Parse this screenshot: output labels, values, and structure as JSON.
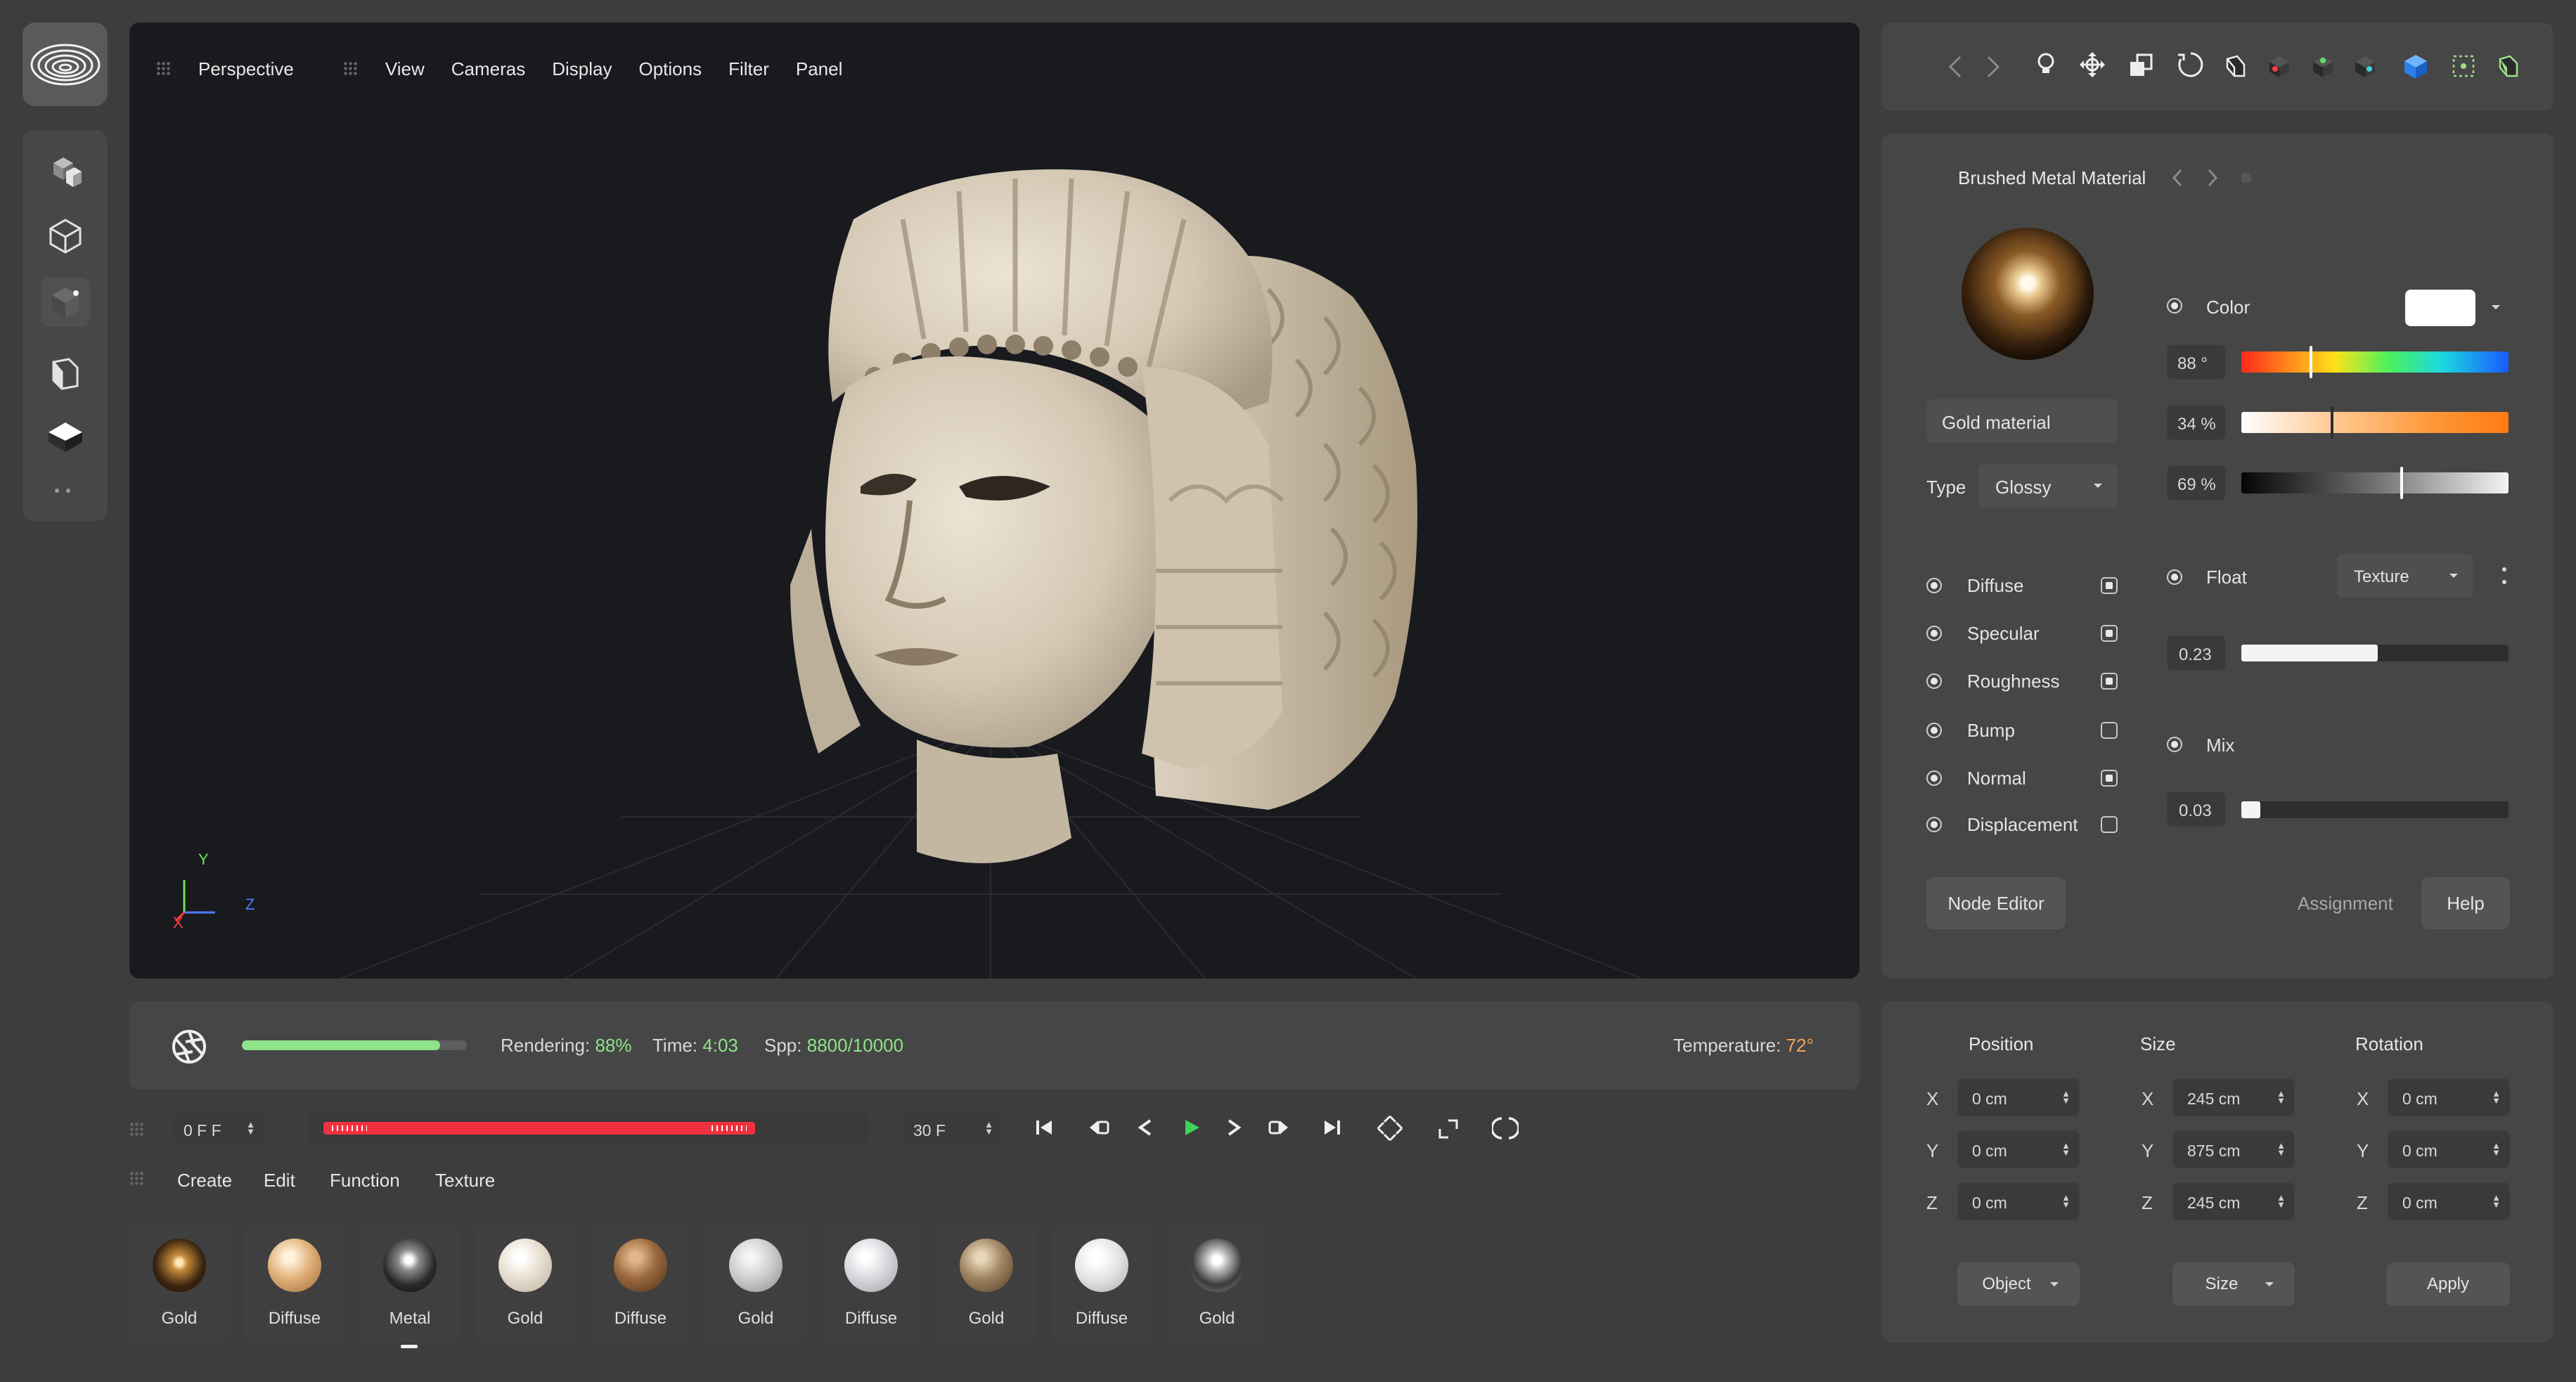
{
  "viewport": {
    "view_mode": "Perspective",
    "menu": [
      "View",
      "Cameras",
      "Display",
      "Options",
      "Filter",
      "Panel"
    ],
    "axes": {
      "x": "X",
      "y": "Y",
      "z": "Z"
    }
  },
  "status": {
    "rendering_label": "Rendering:",
    "rendering_value": "88%",
    "render_progress": 0.88,
    "time_label": "Time:",
    "time_value": "4:03",
    "spp_label": "Spp:",
    "spp_value": "8800/10000",
    "temperature_label": "Temperature:",
    "temperature_value": "72°",
    "accent_green": "#8fe388",
    "accent_orange": "#f0a35a"
  },
  "timeline": {
    "start_frame": "0 F F",
    "end_frame": "30 F",
    "track_color": "#f2313f",
    "menu": [
      "Create",
      "Edit",
      "Function",
      "Texture"
    ]
  },
  "materials": [
    {
      "label": "Gold",
      "icon": "gold-sphere"
    },
    {
      "label": "Diffuse",
      "icon": "diffuse-sphere"
    },
    {
      "label": "Metal",
      "icon": "metal-sphere",
      "selected": true
    },
    {
      "label": "Gold",
      "icon": "gold-sphere"
    },
    {
      "label": "Diffuse",
      "icon": "diffuse-sphere"
    },
    {
      "label": "Gold",
      "icon": "gold-sphere"
    },
    {
      "label": "Diffuse",
      "icon": "diffuse-sphere"
    },
    {
      "label": "Gold",
      "icon": "gold-sphere"
    },
    {
      "label": "Diffuse",
      "icon": "diffuse-sphere"
    },
    {
      "label": "Gold",
      "icon": "gold-sphere"
    }
  ],
  "material_panel": {
    "title": "Brushed Metal Material",
    "name_field": "Gold material",
    "type_label": "Type",
    "type_value": "Glossy",
    "color_label": "Color",
    "color_swatch": "#ffffff",
    "hue": {
      "value": "88 °",
      "level": 0.26
    },
    "saturation": {
      "value": "34 %",
      "level": 0.34
    },
    "brightness": {
      "value": "69 %",
      "level": 0.6
    },
    "channels": [
      {
        "label": "Diffuse",
        "checked": true
      },
      {
        "label": "Specular",
        "checked": true
      },
      {
        "label": "Roughness",
        "checked": true
      },
      {
        "label": "Bump",
        "checked": false
      },
      {
        "label": "Normal",
        "checked": true
      },
      {
        "label": "Displacement",
        "checked": false
      }
    ],
    "float_label": "Float",
    "float_mode": "Texture",
    "float_value": "0.23",
    "float_level": 0.51,
    "mix_label": "Mix",
    "mix_value": "0.03",
    "mix_level": 0.07,
    "node_editor_label": "Node Editor",
    "assignment_label": "Assignment",
    "help_label": "Help"
  },
  "transform": {
    "position_label": "Position",
    "size_label": "Size",
    "rotation_label": "Rotation",
    "axes": [
      "X",
      "Y",
      "Z"
    ],
    "position": [
      "0 cm",
      "0 cm",
      "0 cm"
    ],
    "size": [
      "245 cm",
      "875 cm",
      "245 cm"
    ],
    "rotation": [
      "0 cm",
      "0 cm",
      "0 cm"
    ],
    "object_select": "Object",
    "size_select": "Size",
    "apply_label": "Apply"
  }
}
